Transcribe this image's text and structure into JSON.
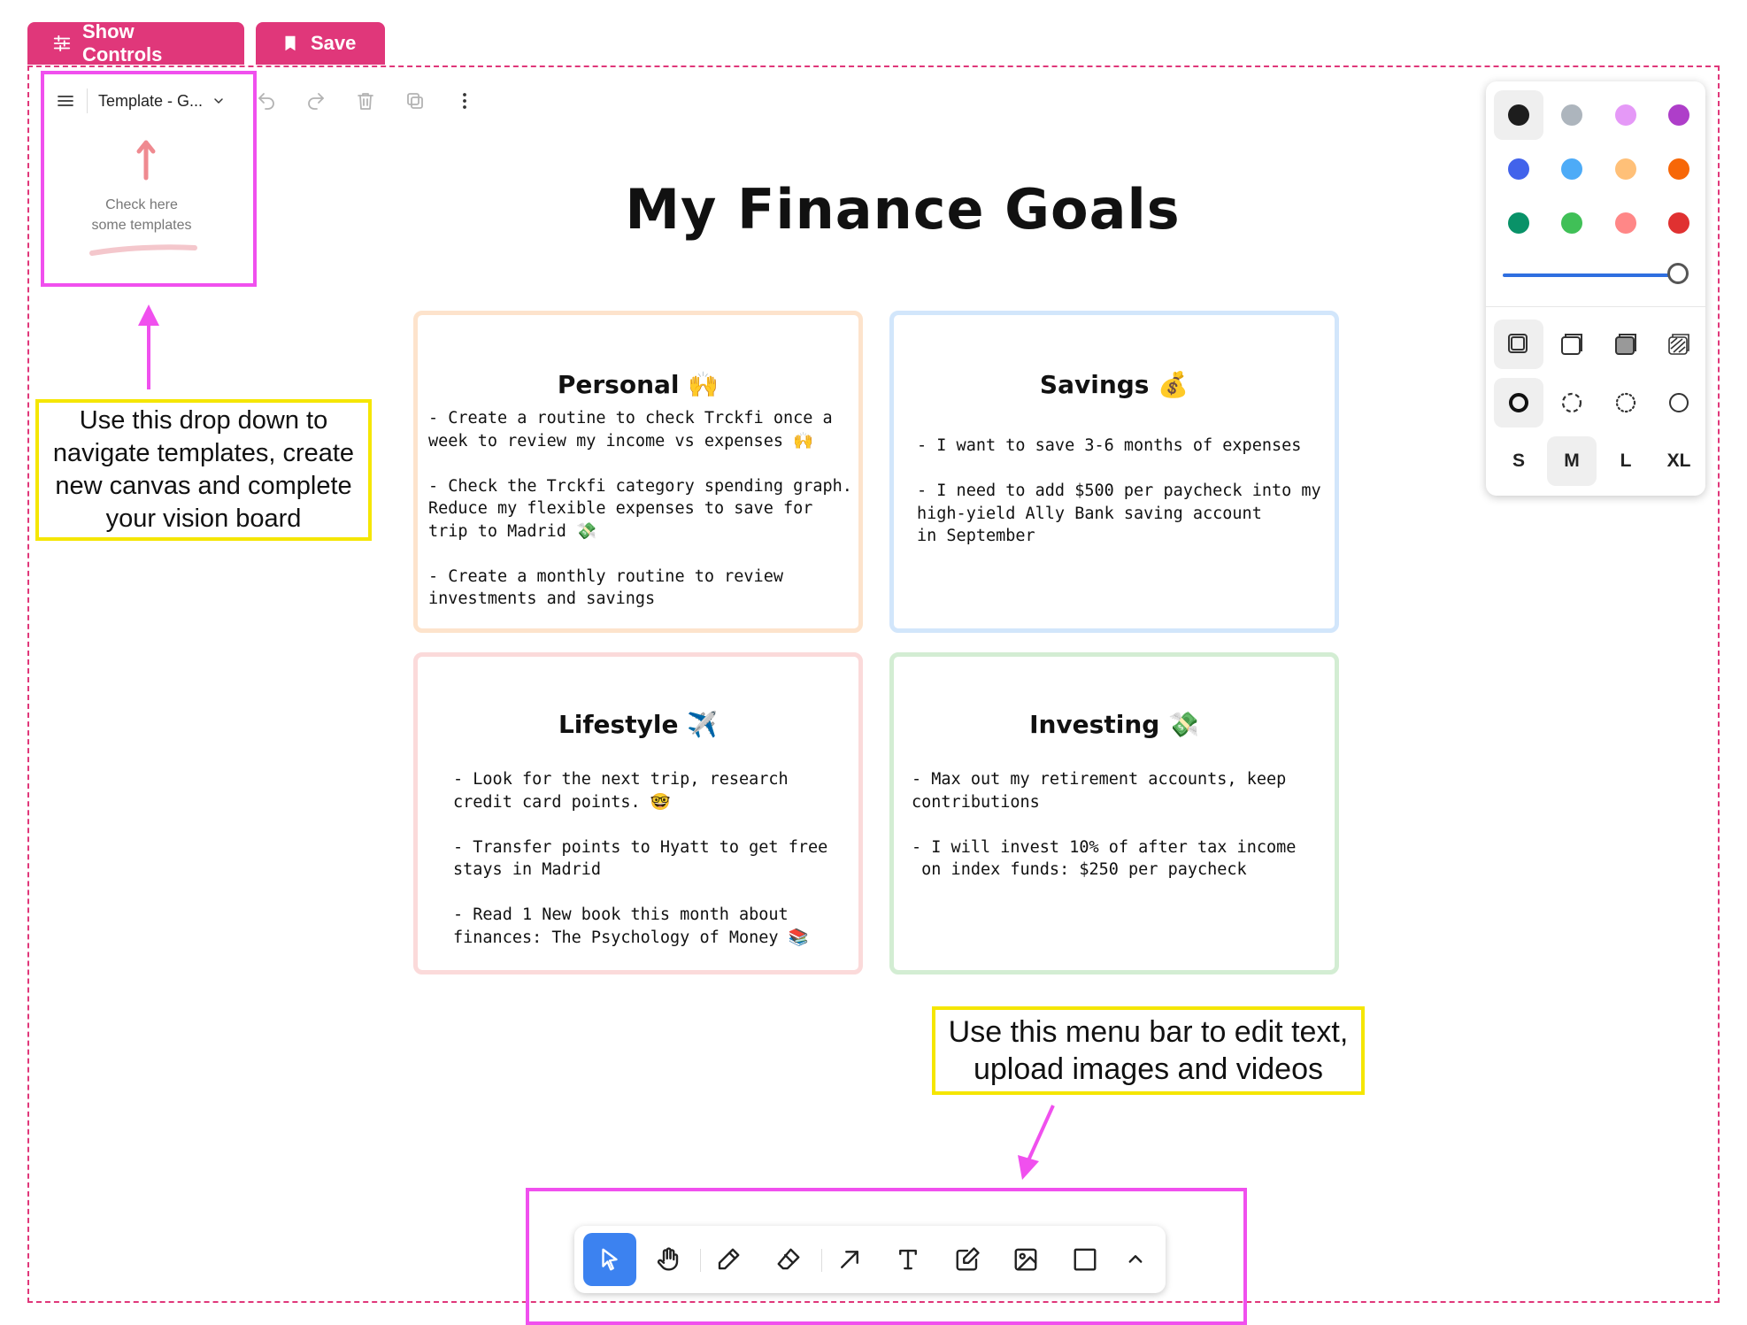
{
  "top_buttons": {
    "show_controls": "Show Controls",
    "save": "Save"
  },
  "menu": {
    "template_name": "Template - G..."
  },
  "template_hint": {
    "line1": "Check here",
    "line2": "some templates"
  },
  "annotations": {
    "dropdown_note": [
      "Use this drop down to",
      "navigate templates, create",
      "new canvas and complete",
      "your vision board"
    ],
    "menubar_note": [
      "Use this menu bar to edit text,",
      "upload images and videos"
    ]
  },
  "board": {
    "title": "My Finance Goals",
    "cards": [
      {
        "title": "Personal 🙌",
        "body": "- Create a routine to check Trckfi once a\nweek to review my income vs expenses 🙌\n\n- Check the Trckfi category spending graph.\nReduce my flexible expenses to save for\ntrip to Madrid 💸\n\n- Create a monthly routine to review\ninvestments and savings",
        "border_color": "#fde3cc"
      },
      {
        "title": "Savings 💰",
        "body": "- I want to save 3-6 months of expenses\n\n- I need to add $500 per paycheck into my\nhigh-yield Ally Bank saving account\nin September",
        "border_color": "#d2e6fb"
      },
      {
        "title": "Lifestyle ✈️",
        "body": "- Look for the next trip, research\ncredit card points. 🤓\n\n- Transfer points to Hyatt to get free\nstays in Madrid\n\n- Read 1 New book this month about\nfinances: The Psychology of Money 📚",
        "border_color": "#fbdada"
      },
      {
        "title": "Investing 💸",
        "body": "- Max out my retirement accounts, keep\ncontributions\n\n- I will invest 10% of after tax income\n on index funds: $250 per paycheck",
        "border_color": "#d3edd3"
      }
    ]
  },
  "style_panel": {
    "colors": [
      "#1d1d1d",
      "#adb5bd",
      "#e599f7",
      "#ae3ec9",
      "#4263eb",
      "#4dabf7",
      "#ffc078",
      "#f76707",
      "#099268",
      "#40c057",
      "#ff8787",
      "#e03131"
    ],
    "selected_color": "#1d1d1d",
    "opacity": 1.0,
    "sizes": [
      "S",
      "M",
      "L",
      "XL"
    ],
    "selected_size": "M"
  },
  "toolbar": {
    "tools": [
      "select-icon",
      "hand-icon",
      "draw-icon",
      "eraser-icon",
      "arrow-icon",
      "text-icon",
      "note-icon",
      "image-icon",
      "rectangle-icon",
      "chevron-up-icon"
    ],
    "active_tool": "select-icon"
  },
  "colors": {
    "accent_pink": "#e0377a",
    "highlight_magenta": "#f050ee",
    "highlight_yellow": "#f5e600",
    "active_blue": "#3c82f0"
  }
}
